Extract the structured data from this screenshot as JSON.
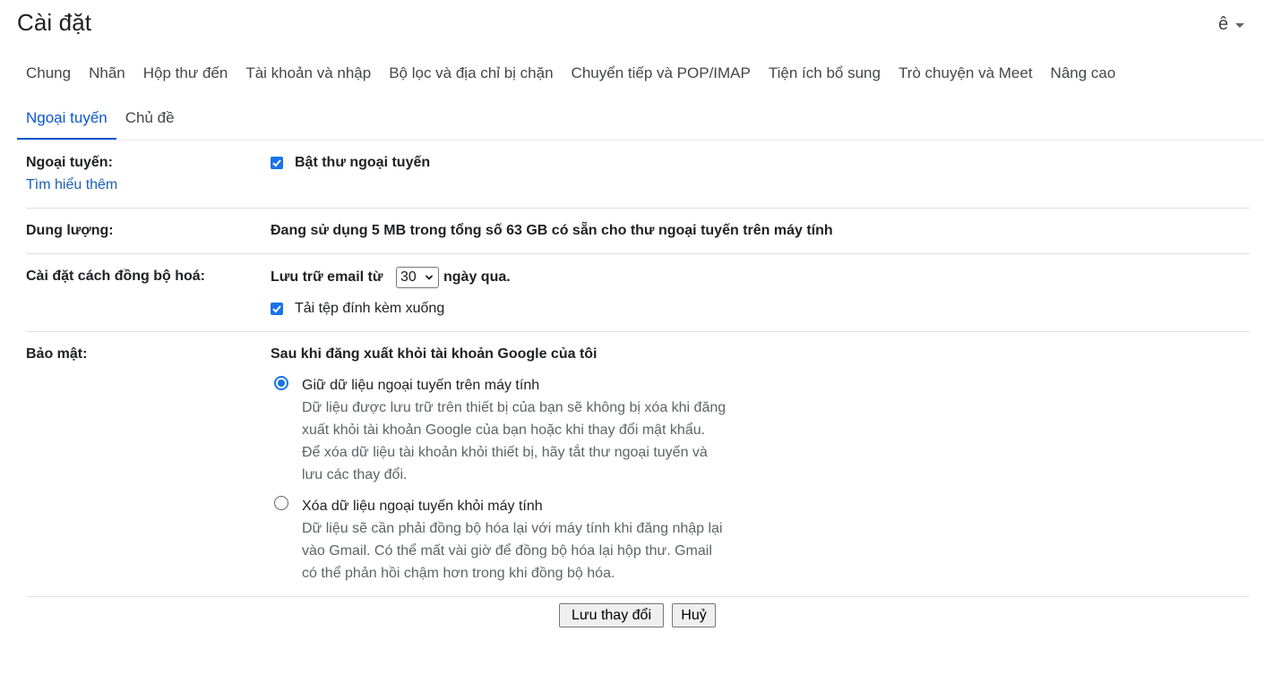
{
  "header": {
    "title": "Cài đặt",
    "lang_glyph": "ê"
  },
  "tabs_row1": [
    "Chung",
    "Nhãn",
    "Hộp thư đến",
    "Tài khoản và nhập",
    "Bộ lọc và địa chỉ bị chặn",
    "Chuyển tiếp và POP/IMAP",
    "Tiện ích bổ sung",
    "Trò chuyện và Meet",
    "Nâng cao"
  ],
  "tabs_row2": [
    "Ngoại tuyến",
    "Chủ đề"
  ],
  "active_tab": "Ngoại tuyến",
  "offline": {
    "label": "Ngoại tuyến:",
    "learn_more": "Tìm hiểu thêm",
    "checkbox_label": "Bật thư ngoại tuyến",
    "checked": true
  },
  "storage": {
    "label": "Dung lượng:",
    "text": "Đang sử dụng 5 MB trong tổng số 63 GB có sẵn cho thư ngoại tuyến trên máy tính"
  },
  "sync": {
    "label": "Cài đặt cách đồng bộ hoá:",
    "prefix": "Lưu trữ email từ",
    "days_value": "30",
    "suffix": "ngày qua.",
    "attachments_label": "Tải tệp đính kèm xuống",
    "attachments_checked": true
  },
  "security": {
    "label": "Bảo mật:",
    "heading": "Sau khi đăng xuất khỏi tài khoản Google của tôi",
    "options": [
      {
        "title": "Giữ dữ liệu ngoại tuyến trên máy tính",
        "desc": [
          "Dữ liệu được lưu trữ trên thiết bị của bạn sẽ không bị xóa khi đăng",
          "xuất khỏi tài khoản Google của bạn hoặc khi thay đổi mật khẩu.",
          "Để xóa dữ liệu tài khoản khỏi thiết bị, hãy tắt thư ngoại tuyến và",
          "lưu các thay đổi."
        ],
        "selected": true
      },
      {
        "title": "Xóa dữ liệu ngoại tuyến khỏi máy tính",
        "desc": [
          "Dữ liệu sẽ cần phải đồng bộ hóa lại với máy tính khi đăng nhập lại",
          "vào Gmail. Có thể mất vài giờ để đồng bộ hóa lại hộp thư. Gmail",
          "có thể phản hồi chậm hơn trong khi đồng bộ hóa."
        ],
        "selected": false
      }
    ]
  },
  "buttons": {
    "save": "Lưu thay đổi",
    "cancel": "Huỷ"
  },
  "colors": {
    "accent": "#1a73e8",
    "active_tab": "#0b57d0",
    "link": "#1a5fb4"
  }
}
